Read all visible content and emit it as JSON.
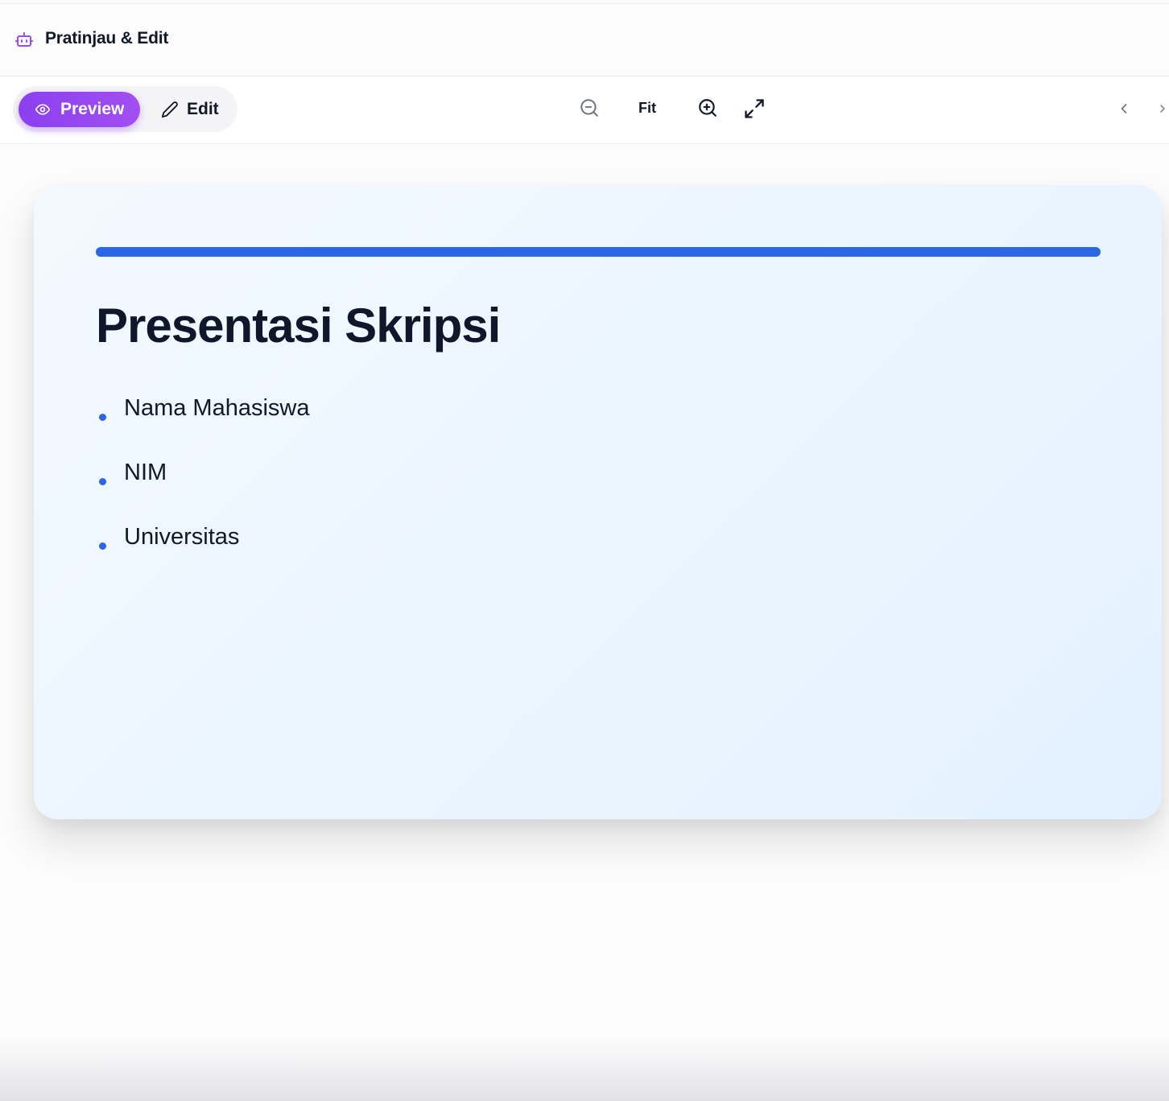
{
  "header": {
    "icon": "bot-icon",
    "title": "Pratinjau & Edit",
    "accent_color": "#9b4bf0"
  },
  "toolbar": {
    "preview_label": "Preview",
    "edit_label": "Edit",
    "active_mode": "Preview",
    "fit_label": "Fit",
    "icons": [
      "eye-icon",
      "pencil-icon",
      "zoom-out-icon",
      "zoom-in-icon",
      "expand-icon",
      "chevron-left-icon",
      "chevron-right-icon"
    ]
  },
  "slide": {
    "title": "Presentasi Skripsi",
    "accent_color": "#2b66e6",
    "bullets": [
      "Nama Mahasiswa",
      "NIM",
      "Universitas"
    ]
  }
}
